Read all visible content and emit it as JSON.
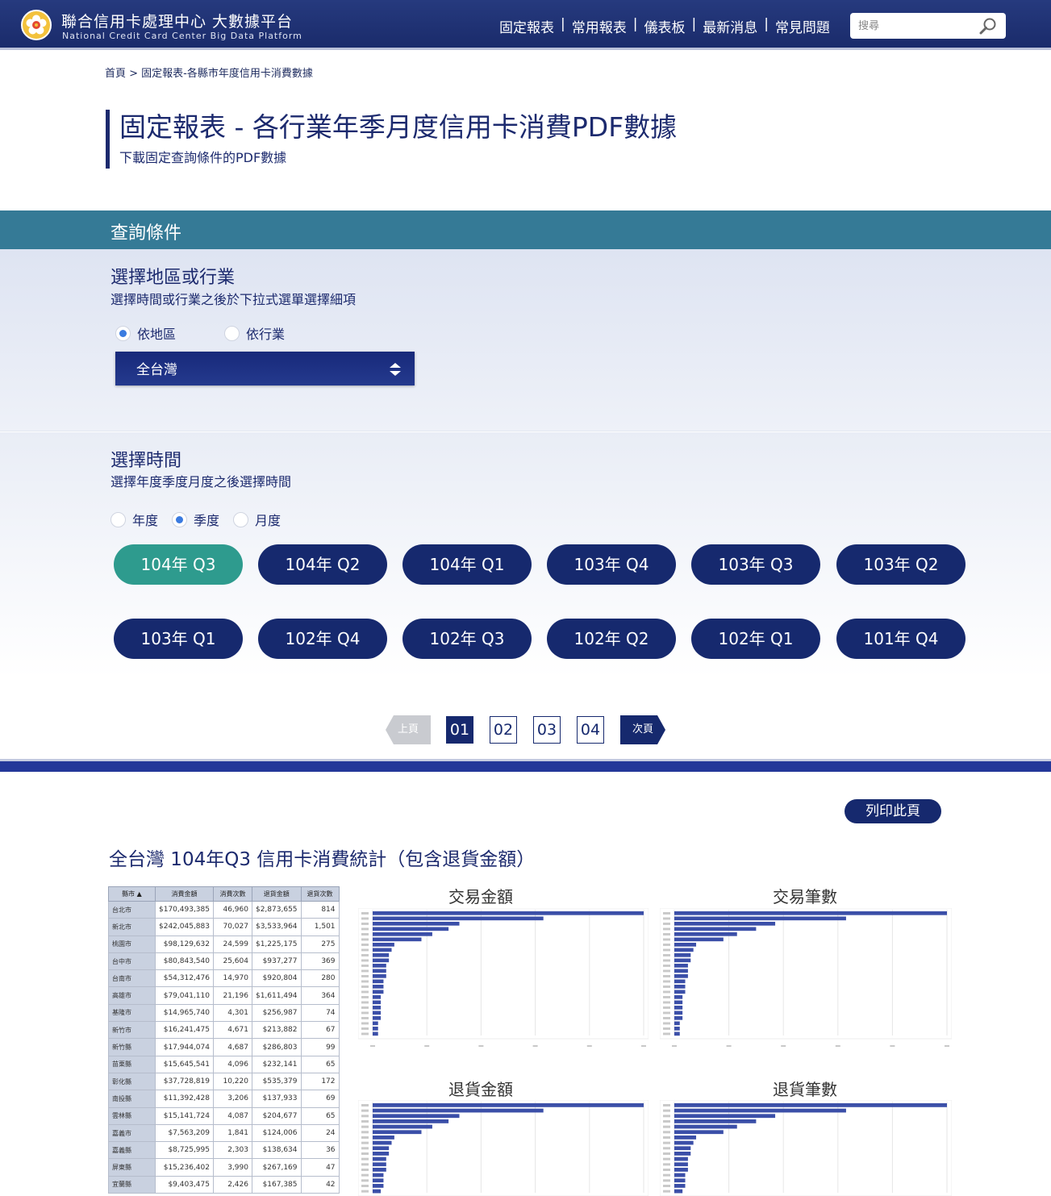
{
  "header": {
    "brand_cn": "聯合信用卡處理中心 大數據平台",
    "brand_en": "National Credit Card Center Big Data Platform",
    "nav": [
      "固定報表",
      "常用報表",
      "儀表板",
      "最新消息",
      "常見問題"
    ],
    "nav_separator": "|",
    "search_placeholder": "搜尋"
  },
  "breadcrumb": "首頁 > 固定報表-各縣市年度信用卡消費數據",
  "page": {
    "title": "固定報表 -  各行業年季月度信用卡消費PDF數據",
    "subtitle": "下載固定查詢條件的PDF數據"
  },
  "query": {
    "header": "查詢條件",
    "region_title": "選擇地區或行業",
    "region_desc": "選擇時間或行業之後於下拉式選單選擇細項",
    "region_options": [
      {
        "label": "依地區",
        "checked": true
      },
      {
        "label": "依行業",
        "checked": false
      }
    ],
    "region_select": "全台灣",
    "time_title": "選擇時間",
    "time_desc": "選擇年度季度月度之後選擇時間",
    "time_options": [
      {
        "label": "年度",
        "checked": false
      },
      {
        "label": "季度",
        "checked": true
      },
      {
        "label": "月度",
        "checked": false
      }
    ],
    "periods": [
      "104年 Q3",
      "104年 Q2",
      "104年 Q1",
      "103年 Q4",
      "103年 Q3",
      "103年 Q2",
      "103年 Q1",
      "102年 Q4",
      "102年 Q3",
      "102年 Q2",
      "102年 Q1",
      "101年 Q4"
    ],
    "active_period": "104年 Q3"
  },
  "pagination": {
    "prev": "上頁",
    "next": "次頁",
    "pages": [
      "01",
      "02",
      "03",
      "04"
    ],
    "current": "01"
  },
  "report": {
    "print_label": "列印此頁",
    "title": "全台灣 104年Q3 信用卡消費統計（包含退貨金額）",
    "table": {
      "headers": [
        "縣市",
        "消費金額",
        "消費次數",
        "退貨金額",
        "退貨次數"
      ],
      "rows": [
        [
          "台北市",
          "$170,493,385",
          "46,960",
          "$2,873,655",
          "814"
        ],
        [
          "新北市",
          "$242,045,883",
          "70,027",
          "$3,533,964",
          "1,501"
        ],
        [
          "桃園市",
          "$98,129,632",
          "24,599",
          "$1,225,175",
          "275"
        ],
        [
          "台中市",
          "$80,843,540",
          "25,604",
          "$937,277",
          "369"
        ],
        [
          "台南市",
          "$54,312,476",
          "14,970",
          "$920,804",
          "280"
        ],
        [
          "高雄市",
          "$79,041,110",
          "21,196",
          "$1,611,494",
          "364"
        ],
        [
          "基隆市",
          "$14,965,740",
          "4,301",
          "$256,987",
          "74"
        ],
        [
          "新竹市",
          "$16,241,475",
          "4,671",
          "$213,882",
          "67"
        ],
        [
          "新竹縣",
          "$17,944,074",
          "4,687",
          "$286,803",
          "99"
        ],
        [
          "苗栗縣",
          "$15,645,541",
          "4,096",
          "$232,141",
          "65"
        ],
        [
          "彰化縣",
          "$37,728,819",
          "10,220",
          "$535,379",
          "172"
        ],
        [
          "南投縣",
          "$11,392,428",
          "3,206",
          "$137,933",
          "69"
        ],
        [
          "雲林縣",
          "$15,141,724",
          "4,087",
          "$204,677",
          "65"
        ],
        [
          "嘉義市",
          "$7,563,209",
          "1,841",
          "$124,006",
          "24"
        ],
        [
          "嘉義縣",
          "$8,725,995",
          "2,303",
          "$138,634",
          "36"
        ],
        [
          "屏東縣",
          "$15,236,402",
          "3,990",
          "$267,169",
          "47"
        ],
        [
          "宜蘭縣",
          "$9,403,475",
          "2,426",
          "$167,385",
          "42"
        ]
      ]
    }
  },
  "chart_data": [
    {
      "type": "bar",
      "title": "交易金額",
      "orientation": "horizontal",
      "values": [
        100,
        63,
        32,
        28,
        22,
        18,
        8,
        7,
        6,
        6,
        5,
        5,
        5,
        4,
        4,
        4,
        3,
        3,
        3,
        3,
        3,
        2,
        2,
        2
      ]
    },
    {
      "type": "bar",
      "title": "交易筆數",
      "orientation": "horizontal",
      "values": [
        100,
        63,
        37,
        30,
        23,
        18,
        8,
        7,
        6,
        6,
        5,
        5,
        5,
        4,
        4,
        4,
        3,
        3,
        3,
        3,
        3,
        2,
        2,
        2
      ]
    },
    {
      "type": "bar",
      "title": "退貨金額",
      "orientation": "horizontal",
      "values": [
        100,
        63,
        32,
        28,
        22,
        18,
        8,
        7,
        6,
        6,
        5,
        5,
        5,
        4,
        4,
        4,
        3,
        3,
        3,
        3,
        3,
        2,
        2,
        2
      ]
    },
    {
      "type": "bar",
      "title": "退貨筆數",
      "orientation": "horizontal",
      "values": [
        100,
        63,
        37,
        30,
        23,
        18,
        8,
        7,
        6,
        6,
        5,
        5,
        5,
        4,
        4,
        4,
        3,
        3,
        3,
        3,
        3,
        2,
        2,
        2
      ]
    }
  ],
  "colors": {
    "navy": "#16296e",
    "teal_active": "#2e9b8e",
    "query_header": "#357a96",
    "bar": "#3b4fa8"
  },
  "icons": {
    "logo": "plum-blossom-logo",
    "search": "search-icon",
    "select": "sort-arrows-icon"
  }
}
